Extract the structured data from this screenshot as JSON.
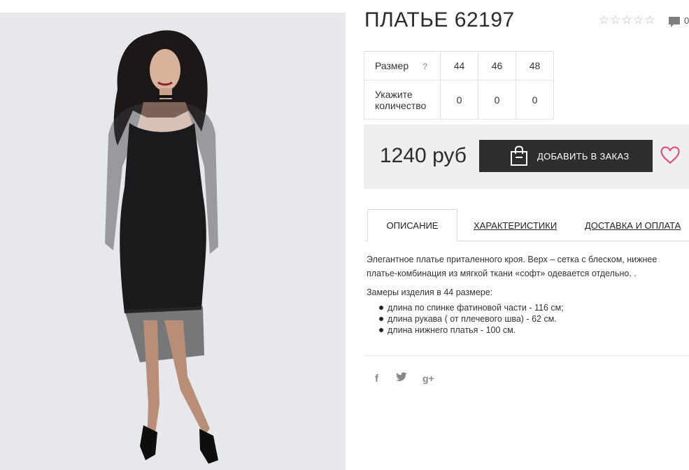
{
  "product": {
    "title": "ПЛАТЬЕ 62197",
    "rating_stars": [
      "☆",
      "☆",
      "☆",
      "☆",
      "☆"
    ],
    "comment_icon": "comment-icon",
    "comment_count": "0"
  },
  "size_table": {
    "size_label": "Размер",
    "help_mark": "?",
    "sizes": [
      "44",
      "46",
      "48"
    ],
    "quantity_label_line1": "Укажите",
    "quantity_label_line2": "количество",
    "quantities": [
      "0",
      "0",
      "0"
    ]
  },
  "purchase": {
    "price": "1240 руб",
    "add_button_label": "ДОБАВИТЬ В ЗАКАЗ",
    "bag_icon": "shopping-bag-icon",
    "wishlist_icon": "heart-icon",
    "accent_color": "#e0457b",
    "button_color": "#2e2e2e"
  },
  "tabs": {
    "description": "ОПИСАНИЕ",
    "characteristics": "ХАРАКТЕРИСТИКИ",
    "delivery": "ДОСТАВКА И ОПЛАТА"
  },
  "description": {
    "text": "Элегантное платье приталенного кроя. Верх – сетка с блеском, нижнее платье-комбинация из мягкой ткани «софт» одевается отдельно. .",
    "measure_title": "Замеры изделия в 44 размере:",
    "measures": [
      "длина по спинке фатиновой части - 116 см;",
      "длина рукава ( от плечевого шва) - 62 см.",
      "длина нижнего платья - 100 см."
    ]
  },
  "social": {
    "facebook": "f",
    "twitter": "🐦",
    "google_plus": "g+"
  }
}
